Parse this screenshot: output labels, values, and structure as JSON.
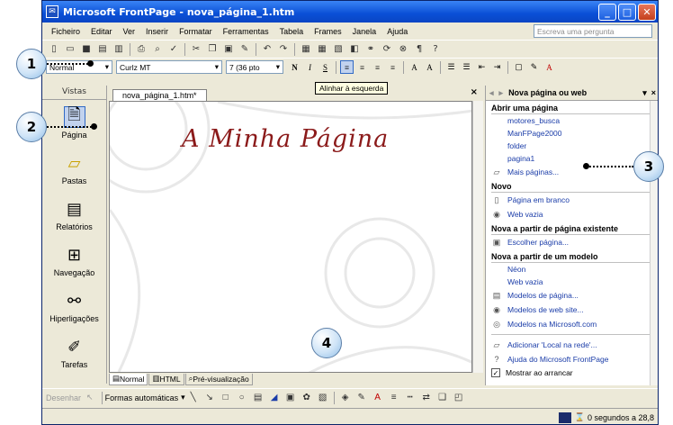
{
  "window": {
    "title": "Microsoft FrontPage - nova_página_1.htm",
    "minimize_label": "_",
    "maximize_label": "□",
    "close_label": "✕"
  },
  "menu": {
    "items": [
      "Ficheiro",
      "Editar",
      "Ver",
      "Inserir",
      "Formatar",
      "Ferramentas",
      "Tabela",
      "Frames",
      "Janela",
      "Ajuda"
    ],
    "help_placeholder": "Escreva uma pergunta"
  },
  "formatting": {
    "style": "Normal",
    "font": "Curlz MT",
    "size": "7 (36 pto",
    "bold": "N",
    "italic": "I",
    "underline": "S"
  },
  "tooltip": "Alinhar à esquerda",
  "views": {
    "header": "Vistas",
    "items": [
      {
        "label": "Página",
        "icon": "page-icon"
      },
      {
        "label": "Pastas",
        "icon": "folder-icon"
      },
      {
        "label": "Relatórios",
        "icon": "reports-icon"
      },
      {
        "label": "Navegação",
        "icon": "navigation-icon"
      },
      {
        "label": "Hiperligações",
        "icon": "hyperlinks-icon"
      },
      {
        "label": "Tarefas",
        "icon": "tasks-icon"
      }
    ]
  },
  "document": {
    "tab": "nova_página_1.htm*",
    "heading": "A Minha Página",
    "view_tabs": [
      "Normal",
      "HTML",
      "Pré-visualização"
    ],
    "heading_color": "#8b1a1a"
  },
  "taskpane": {
    "title": "Nova página ou web",
    "sections": [
      {
        "title": "Abrir uma página",
        "links": [
          "motores_busca",
          "ManFPage2000",
          "folder",
          "pagina1"
        ],
        "icon_links": [
          "Mais páginas..."
        ]
      },
      {
        "title": "Novo",
        "links": [],
        "icon_links": [
          "Página em branco",
          "Web vazia"
        ]
      },
      {
        "title": "Nova a partir de página existente",
        "links": [],
        "icon_links": [
          "Escolher página..."
        ]
      },
      {
        "title": "Nova a partir de um modelo",
        "links": [
          "Néon",
          "Web vazia"
        ],
        "icon_links": [
          "Modelos de página...",
          "Modelos de web site...",
          "Modelos na Microsoft.com"
        ]
      }
    ],
    "footer_links": [
      "Adicionar 'Local na rede'...",
      "Ajuda do Microsoft FrontPage"
    ],
    "show_at_startup": "Mostrar ao arrancar"
  },
  "drawing": {
    "draw_label": "Desenhar",
    "autoshapes_label": "Formas automáticas"
  },
  "status": {
    "text": "0 segundos a 28,8"
  },
  "callouts": [
    "1",
    "2",
    "3",
    "4"
  ]
}
